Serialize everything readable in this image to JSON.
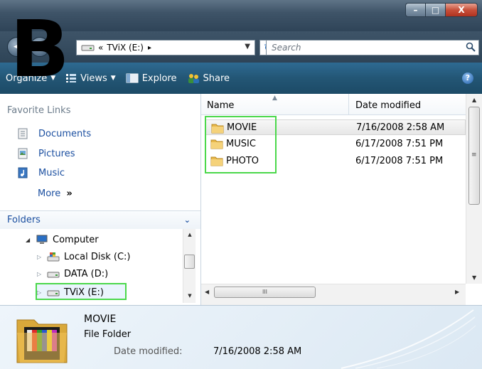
{
  "window": {
    "title": "",
    "controls": {
      "minimize": "–",
      "maximize": "□",
      "close": "X"
    }
  },
  "overlay_letter": "B",
  "address": {
    "path_prefix": "«",
    "path": "TViX (E:)",
    "separator": "▸",
    "search_placeholder": "Search"
  },
  "toolbar": {
    "organize": "Organize",
    "views": "Views",
    "explore": "Explore",
    "share": "Share",
    "help": "?"
  },
  "nav": {
    "favorites_heading": "Favorite Links",
    "favorites": [
      {
        "label": "Documents",
        "icon": "documents-icon"
      },
      {
        "label": "Pictures",
        "icon": "pictures-icon"
      },
      {
        "label": "Music",
        "icon": "music-icon"
      }
    ],
    "more": "More",
    "more_glyph": "»",
    "folders_heading": "Folders",
    "tree": [
      {
        "label": "Computer",
        "icon": "computer-icon"
      },
      {
        "label": "Local Disk (C:)",
        "icon": "local-disk-icon"
      },
      {
        "label": "DATA (D:)",
        "icon": "drive-icon"
      },
      {
        "label": "TViX (E:)",
        "icon": "drive-icon"
      }
    ]
  },
  "content": {
    "columns": {
      "name": "Name",
      "date": "Date modified"
    },
    "files": [
      {
        "name": "MOVIE",
        "date": "7/16/2008 2:58 AM",
        "selected": true
      },
      {
        "name": "MUSIC",
        "date": "6/17/2008 7:51 PM",
        "selected": false
      },
      {
        "name": "PHOTO",
        "date": "6/17/2008 7:51 PM",
        "selected": false
      }
    ],
    "hscroll_grip": "III",
    "vscroll_grip": "≡"
  },
  "details": {
    "name": "MOVIE",
    "type": "File Folder",
    "date_label": "Date modified:",
    "date_value": "7/16/2008 2:58 AM"
  },
  "colors": {
    "highlight_box": "#4bd84b",
    "link_blue": "#1b4fa0",
    "toolbar_top": "#2e6a92",
    "toolbar_bottom": "#1c4a66"
  }
}
